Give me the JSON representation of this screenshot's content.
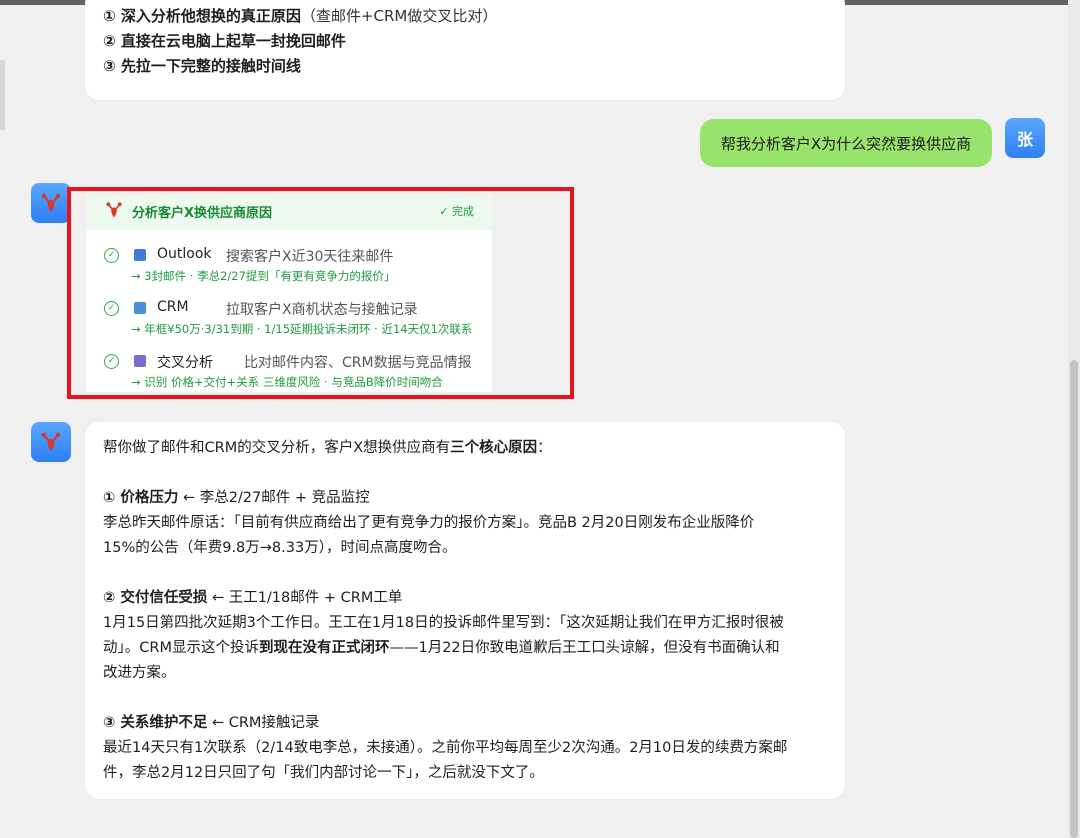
{
  "avatars": {
    "user_initial": "张"
  },
  "prev_reply": {
    "options": [
      {
        "bold": "① 深入分析他想换的真正原因",
        "rest": "（查邮件+CRM做交叉比对）"
      },
      {
        "bold": "② 直接在云电脑上起草一封挽回邮件",
        "rest": ""
      },
      {
        "bold": "③ 先拉一下完整的接触时间线",
        "rest": ""
      }
    ]
  },
  "user_message": "帮我分析客户X为什么突然要换供应商",
  "task_card": {
    "title": "分析客户X换供应商原因",
    "status": "✓ 完成",
    "steps": [
      {
        "icon": "outlook-icon",
        "icon_color": "#3d7bd9",
        "name": "Outlook",
        "desc": "搜索客户X近30天往来邮件",
        "result": "→ 3封邮件 · 李总2/27提到「有更有竞争力的报价」"
      },
      {
        "icon": "crm-icon",
        "icon_color": "#4b8fd6",
        "name": "CRM",
        "desc": "拉取客户X商机状态与接触记录",
        "result": "→ 年框¥50万·3/31到期 · 1/15延期投诉未闭环 · 近14天仅1次联系"
      },
      {
        "icon": "chart-icon",
        "icon_color": "#7a6bd1",
        "name": "交叉分析",
        "desc": "比对邮件内容、CRM数据与竞品情报",
        "result": "→ 识别 价格+交付+关系 三维度风险 · 与竞品B降价时间吻合"
      }
    ]
  },
  "analysis": {
    "intro_a": "帮你做了邮件和CRM的交叉分析，客户X想换供应商有",
    "intro_b": "三个核心原因",
    "intro_c": "：",
    "r1_title": "① 价格压力",
    "r1_src": " ← 李总2/27邮件 + 竞品监控",
    "r1_l1": "李总昨天邮件原话：「目前有供应商给出了更有竞争力的报价方案」。竞品B 2月20日刚发布企业版降价",
    "r1_l2": "15%的公告（年费9.8万→8.33万），时间点高度吻合。",
    "r2_title": "② 交付信任受损",
    "r2_src": " ← 王工1/18邮件 + CRM工单",
    "r2_l1": "1月15日第四批次延期3个工作日。王工在1月18日的投诉邮件里写到：「这次延期让我们在甲方汇报时很被",
    "r2_l2a": "动」。CRM显示这个投诉",
    "r2_l2b": "到现在没有正式闭环",
    "r2_l2c": "——1月22日你致电道歉后王工口头谅解，但没有书面确认和",
    "r2_l3": "改进方案。",
    "r3_title": "③ 关系维护不足",
    "r3_src": " ← CRM接触记录",
    "r3_l1": "最近14天只有1次联系（2/14致电李总，未接通）。之前你平均每周至少2次沟通。2月10日发的续费方案邮",
    "r3_l2": "件，李总2月12日只回了句「我们内部讨论一下」，之后就没下文了。"
  }
}
